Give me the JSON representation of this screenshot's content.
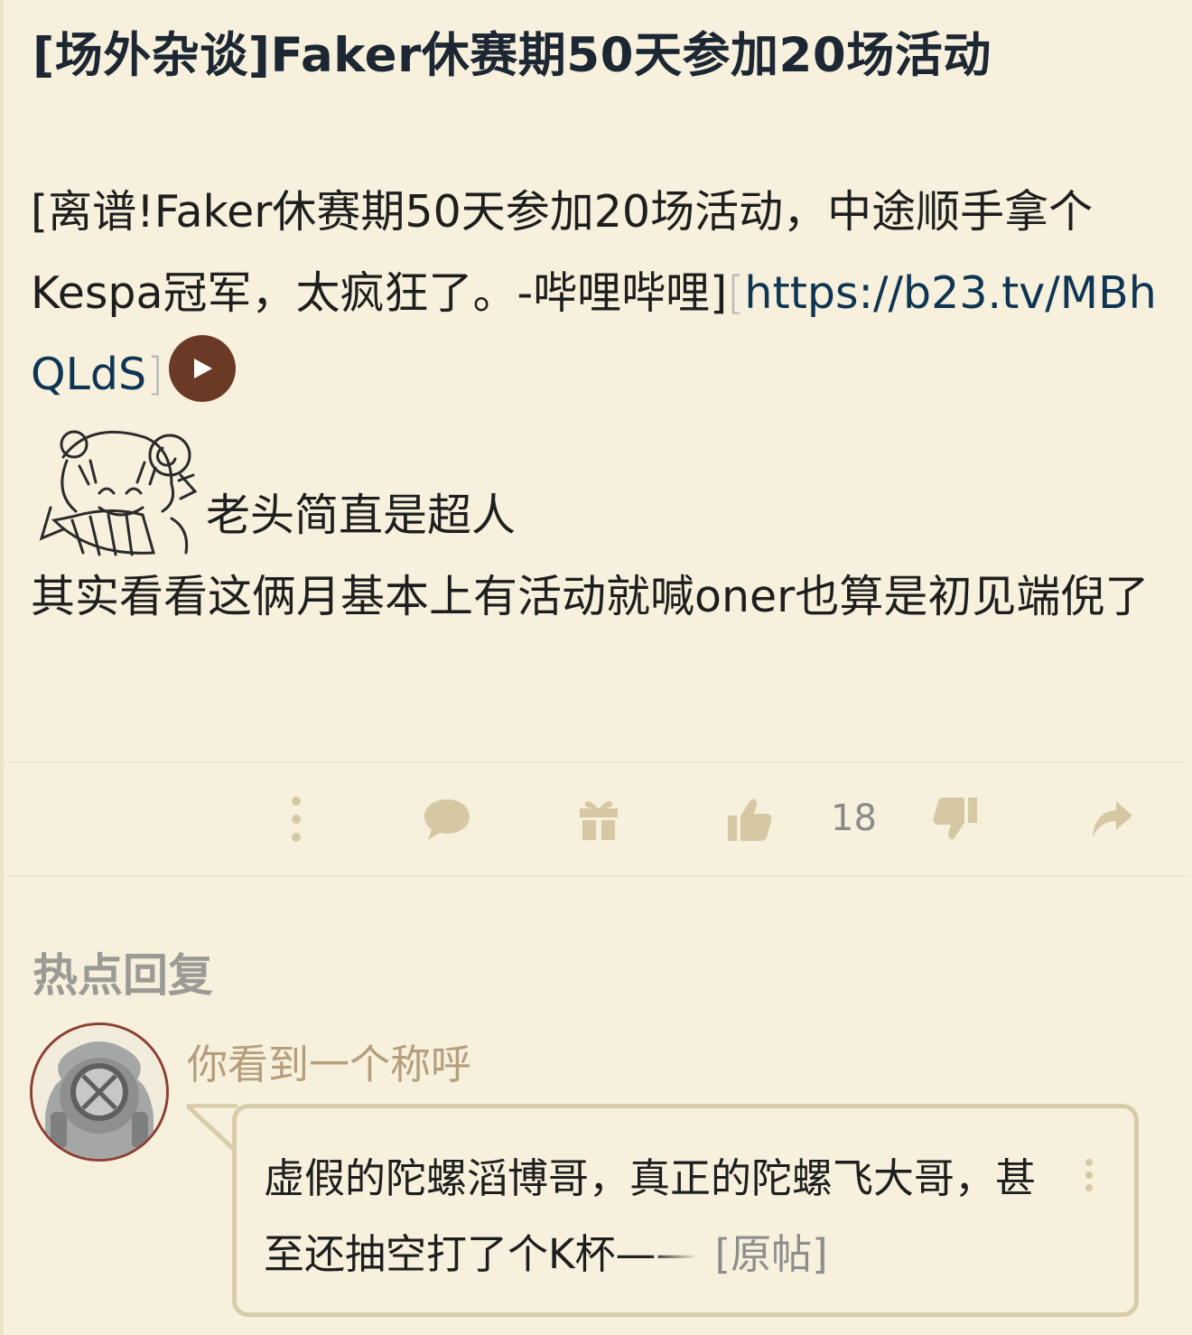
{
  "post": {
    "title": "[场外杂谈]Faker休赛期50天参加20场活动",
    "link_text_pre": "[离谱!Faker休赛期50天参加20场活动，中途顺手拿个Kespa冠军，太疯狂了。-哔哩哔哩]",
    "bracket_open": "[",
    "link_url": "https://b23.tv/MBhQLdS",
    "bracket_close": "]",
    "sticker_caption": "老头简直是超人",
    "body_text": "其实看看这俩月基本上有活动就喊oner也算是初见端倪了"
  },
  "actions": {
    "icons": [
      "more-vertical-icon",
      "comment-icon",
      "gift-icon",
      "thumbs-up-icon",
      "thumbs-down-icon",
      "share-icon"
    ],
    "like_count": "18",
    "icon_color": "#d7c8a4"
  },
  "hot_replies": {
    "section_title": "热点回复",
    "items": [
      {
        "username": "你看到一个称呼",
        "text_main": "虚假的陀螺滔博哥，真正的陀螺飞大哥，甚至还抽空打了个K杯",
        "text_fade": "——",
        "original_link": "[原帖]"
      }
    ]
  },
  "colors": {
    "background": "#f6f0dc",
    "link": "#0e3553",
    "username": "#b49e7d",
    "play_button": "#6b3a26",
    "avatar_border": "#8c3f33"
  }
}
